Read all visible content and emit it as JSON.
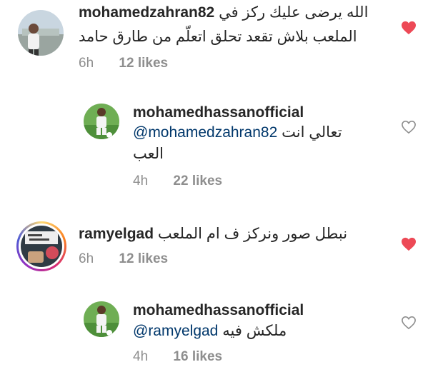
{
  "comments": [
    {
      "username": "mohamedzahran82",
      "text_line1": "الله يرضى عليك ركز في",
      "text_line2": "الملعب بلاش تقعد تحلق اتعلّم من طارق حامد",
      "time": "6h",
      "likes": "12 likes",
      "liked": true,
      "heart_color": "#ed4956"
    },
    {
      "username": "mohamedhassanofficial",
      "mention": "@mohamedzahran82",
      "text_line1": "تعالي انت",
      "text_line2": "العب",
      "time": "4h",
      "likes": "22 likes",
      "liked": false,
      "heart_color": "#8e8e8e"
    },
    {
      "username": "ramyelgad",
      "text_line1": "نبطل صور ونركز ف ام الملعب",
      "time": "6h",
      "likes": "12 likes",
      "liked": true,
      "heart_color": "#ed4956"
    },
    {
      "username": "mohamedhassanofficial",
      "mention": "@ramyelgad",
      "text_line1": "ملكش فيه",
      "time": "4h",
      "likes": "16 likes",
      "liked": false,
      "heart_color": "#8e8e8e"
    }
  ],
  "icons": {
    "heart_filled": "heart-filled-icon",
    "heart_outline": "heart-outline-icon"
  },
  "colors": {
    "text": "#262626",
    "secondary": "#8e8e8e",
    "mention": "#00376b",
    "like_red": "#ed4956"
  }
}
